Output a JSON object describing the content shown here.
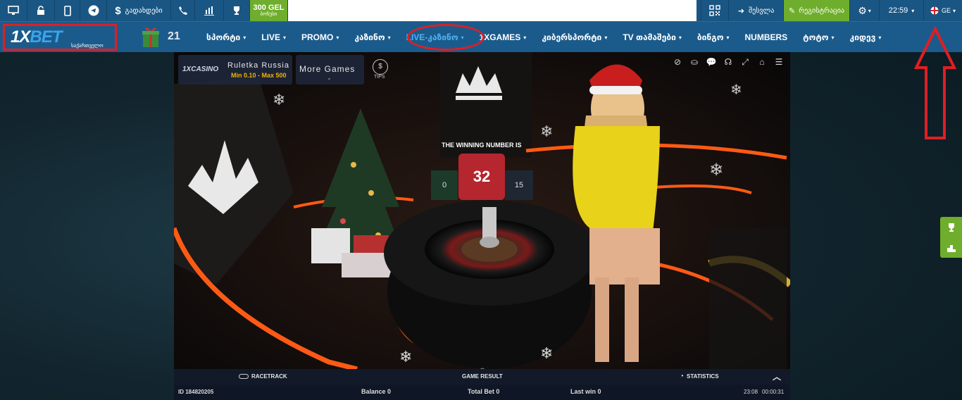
{
  "topbar": {
    "deposit_label": "გადახდები",
    "bonus_amount": "300 GEL",
    "bonus_sub": "ბონუსი",
    "login_label": "შესვლა",
    "register_label": "რეგისტრაცია",
    "time": "22:59",
    "language": "GE"
  },
  "logo": {
    "brand_left": "1X",
    "brand_right": "BET",
    "subtitle": "საქართველო"
  },
  "nav": {
    "promo_number": "21",
    "items": [
      {
        "label": "სპორტი",
        "chevron": "▾"
      },
      {
        "label": "LIVE",
        "chevron": "▾"
      },
      {
        "label": "PROMO",
        "chevron": "▾"
      },
      {
        "label": "კაზინო",
        "chevron": "▾"
      },
      {
        "label": "LIVE-კაზინო",
        "chevron": "▾"
      },
      {
        "label": "1XGAMES",
        "chevron": "▾"
      },
      {
        "label": "კიბერსპორტი",
        "chevron": "▾"
      },
      {
        "label": "TV თამაშები",
        "chevron": "▾"
      },
      {
        "label": "ბინგო",
        "chevron": "▾"
      },
      {
        "label": "NUMBERS",
        "chevron": ""
      },
      {
        "label": "ტოტო",
        "chevron": "▾"
      },
      {
        "label": "კიდევ",
        "chevron": "▾"
      }
    ]
  },
  "game": {
    "casino_logo": "1XCASINO",
    "table_name": "Ruletka Russia",
    "limits": "Min 0.10 - Max 500",
    "more_games": "More Games",
    "more_games_chevron": "⌄",
    "tips_symbol": "$",
    "tips": "TIPS",
    "winning_label": "THE WINNING NUMBER IS",
    "winning_number": "32",
    "prev_left": "0",
    "prev_right": "15",
    "expand_chevron": "︽",
    "racetrack": "RACETRACK",
    "game_result": "GAME RESULT",
    "statistics": "STATISTICS",
    "collapse_chevron": "︿",
    "round_id": "ID 184820205",
    "balance": "Balance  0",
    "total_bet": "Total Bet 0",
    "last_win": "Last win 0",
    "clock": "23:08",
    "elapsed": "00:00:31"
  },
  "colors": {
    "topbar": "#1a5684",
    "navbar": "#1b5b8c",
    "accent_green": "#6fae2c",
    "active_link": "#4fb2f0",
    "annotation_red": "#e01e23",
    "win_red": "#b5262e"
  }
}
